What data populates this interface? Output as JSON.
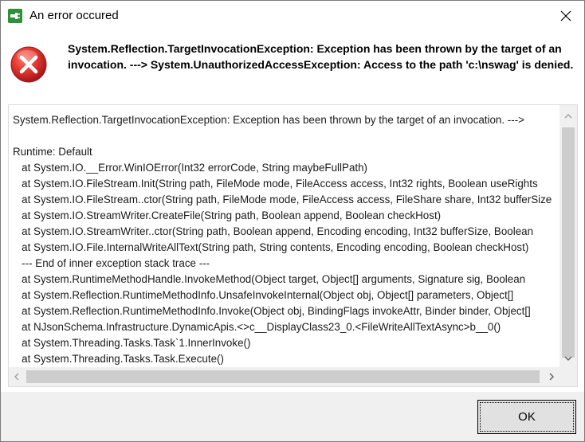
{
  "window": {
    "title": "An error occured",
    "app_icon": "plug-icon",
    "close_icon": "close-icon"
  },
  "message": {
    "icon": "error-icon",
    "text": "System.Reflection.TargetInvocationException: Exception has been thrown by the target of an invocation. ---> System.UnauthorizedAccessException: Access to the path 'c:\\nswag' is denied."
  },
  "details": {
    "lines": [
      "System.Reflection.TargetInvocationException: Exception has been thrown by the target of an invocation. --->",
      "",
      "Runtime: Default",
      "   at System.IO.__Error.WinIOError(Int32 errorCode, String maybeFullPath)",
      "   at System.IO.FileStream.Init(String path, FileMode mode, FileAccess access, Int32 rights, Boolean useRights",
      "   at System.IO.FileStream..ctor(String path, FileMode mode, FileAccess access, FileShare share, Int32 bufferSize",
      "   at System.IO.StreamWriter.CreateFile(String path, Boolean append, Boolean checkHost)",
      "   at System.IO.StreamWriter..ctor(String path, Boolean append, Encoding encoding, Int32 bufferSize, Boolean",
      "   at System.IO.File.InternalWriteAllText(String path, String contents, Encoding encoding, Boolean checkHost)",
      "   --- End of inner exception stack trace ---",
      "   at System.RuntimeMethodHandle.InvokeMethod(Object target, Object[] arguments, Signature sig, Boolean",
      "   at System.Reflection.RuntimeMethodInfo.UnsafeInvokeInternal(Object obj, Object[] parameters, Object[]",
      "   at System.Reflection.RuntimeMethodInfo.Invoke(Object obj, BindingFlags invokeAttr, Binder binder, Object[]",
      "   at NJsonSchema.Infrastructure.DynamicApis.<>c__DisplayClass23_0.<FileWriteAllTextAsync>b__0()",
      "   at System.Threading.Tasks.Task`1.InnerInvoke()",
      "   at System.Threading.Tasks.Task.Execute()"
    ]
  },
  "footer": {
    "ok_label": "OK"
  },
  "colors": {
    "footer_bg": "#f0f0f0",
    "error_red": "#d9302c",
    "app_icon_green": "#2f8f3a"
  }
}
